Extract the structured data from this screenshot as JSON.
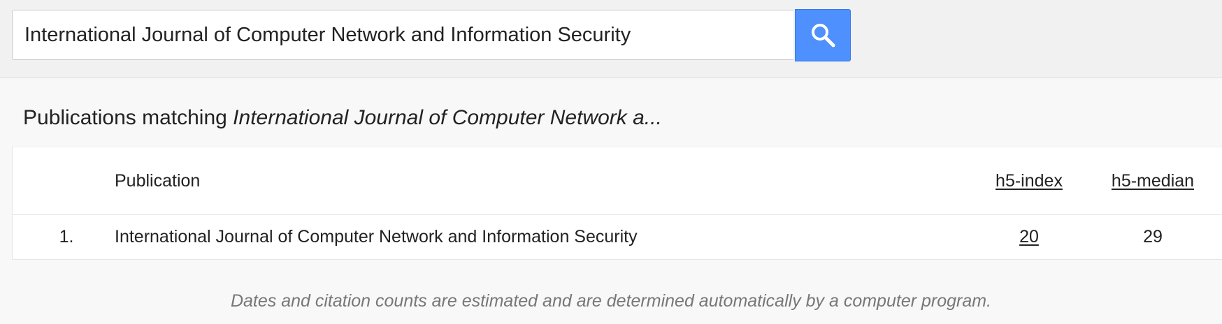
{
  "search": {
    "value": "International Journal of Computer Network and Information Security",
    "button_icon": "search-icon",
    "button_color": "#4d90fe"
  },
  "results": {
    "heading_prefix": "Publications matching",
    "heading_query": "International Journal of Computer Network a..."
  },
  "table": {
    "headers": {
      "publication": "Publication",
      "h5_index": "h5-index",
      "h5_median": "h5-median"
    },
    "rows": [
      {
        "rank": "1.",
        "publication": "International Journal of Computer Network and Information Security",
        "h5_index": "20",
        "h5_median": "29"
      }
    ]
  },
  "footer": {
    "note": "Dates and citation counts are estimated and are determined automatically by a computer program."
  }
}
